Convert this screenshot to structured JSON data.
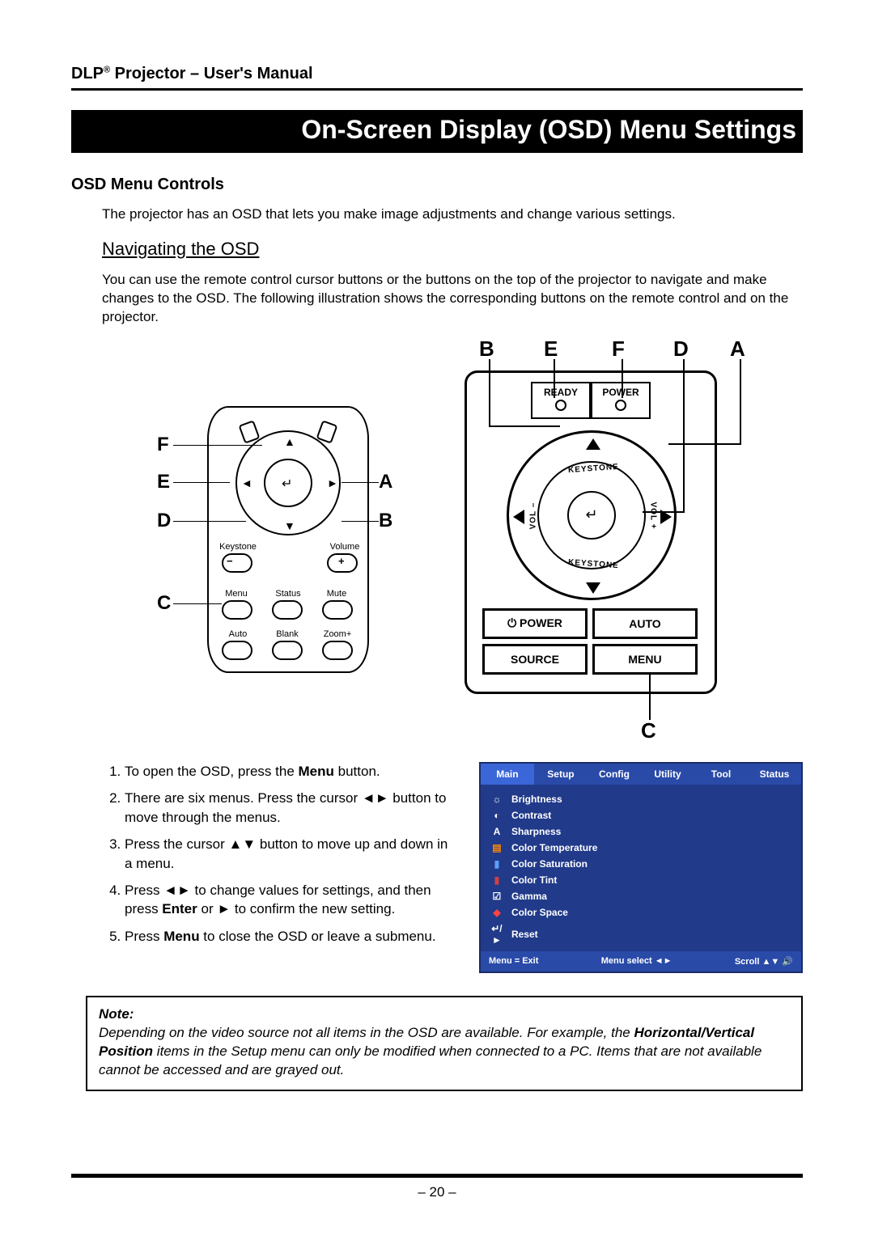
{
  "header": {
    "brand_prefix": "DLP",
    "brand_suffix": "®",
    "title_rest": " Projector – User's Manual"
  },
  "chapter_title": "On-Screen Display (OSD) Menu Settings",
  "section_heading": "OSD Menu Controls",
  "intro_paragraph": "The projector has an OSD that lets you make image adjustments and change various settings.",
  "subsection_heading": "Navigating the OSD",
  "nav_paragraph": "You can use the remote control cursor buttons or the buttons on the top of the projector to navigate and make changes to the OSD. The following illustration shows the corresponding buttons on the remote control and on the projector.",
  "remote": {
    "letters": {
      "A": "A",
      "B": "B",
      "C": "C",
      "D": "D",
      "E": "E",
      "F": "F"
    },
    "keystone": "Keystone",
    "volume": "Volume",
    "menu": "Menu",
    "status": "Status",
    "mute": "Mute",
    "auto": "Auto",
    "blank": "Blank",
    "zoom": "Zoom+",
    "plus": "+",
    "minus": "−"
  },
  "panel": {
    "ready": "READY",
    "power_led": "POWER",
    "keystone_arc1": "KEYSTONE",
    "keystone_arc2": "KEYSTONE",
    "vol_minus": "VOL –",
    "vol_plus": "VOL +",
    "power_btn": "⏻ POWER",
    "auto_btn": "AUTO",
    "source_btn": "SOURCE",
    "menu_btn": "MENU",
    "letters": {
      "A": "A",
      "B": "B",
      "C": "C",
      "D": "D",
      "E": "E",
      "F": "F"
    },
    "enter": "↵"
  },
  "instructions": {
    "i1a": "To open the OSD, press the ",
    "i1b": "Menu",
    "i1c": " button.",
    "i2": "There are six menus. Press the cursor ◄► button to move through the menus.",
    "i3": "Press the cursor ▲▼ button to move up and down in a menu.",
    "i4a": "Press ◄► to change values for settings, and then press ",
    "i4b": "Enter",
    "i4c": " or ► to confirm the new setting.",
    "i5a": "Press ",
    "i5b": "Menu",
    "i5c": " to close the OSD or leave a submenu."
  },
  "osd": {
    "tabs": [
      "Main",
      "Setup",
      "Config",
      "Utility",
      "Tool",
      "Status"
    ],
    "active_tab_index": 0,
    "items": [
      {
        "icon": "☼",
        "label": "Brightness"
      },
      {
        "icon": "◐",
        "label": "Contrast"
      },
      {
        "icon": "A",
        "label": "Sharpness"
      },
      {
        "icon": "▤",
        "label": "Color Temperature"
      },
      {
        "icon": "▮",
        "label": "Color Saturation"
      },
      {
        "icon": "▮",
        "label": "Color Tint"
      },
      {
        "icon": "☑",
        "label": "Gamma"
      },
      {
        "icon": "◆",
        "label": "Color Space"
      },
      {
        "icon": "↵/►",
        "label": "Reset"
      }
    ],
    "footer": {
      "left": "Menu = Exit",
      "mid": "Menu select   ◄►",
      "right": "Scroll   ▲▼   🔊"
    }
  },
  "note": {
    "heading": "Note:",
    "text_a": "Depending on the video source not all items in the OSD are available. For example, the ",
    "text_bold": "Horizontal/Vertical Position",
    "text_b": " items in the Setup menu can only be modified when connected to a PC. Items that are not available cannot be accessed and are grayed out."
  },
  "page_number": "– 20 –"
}
